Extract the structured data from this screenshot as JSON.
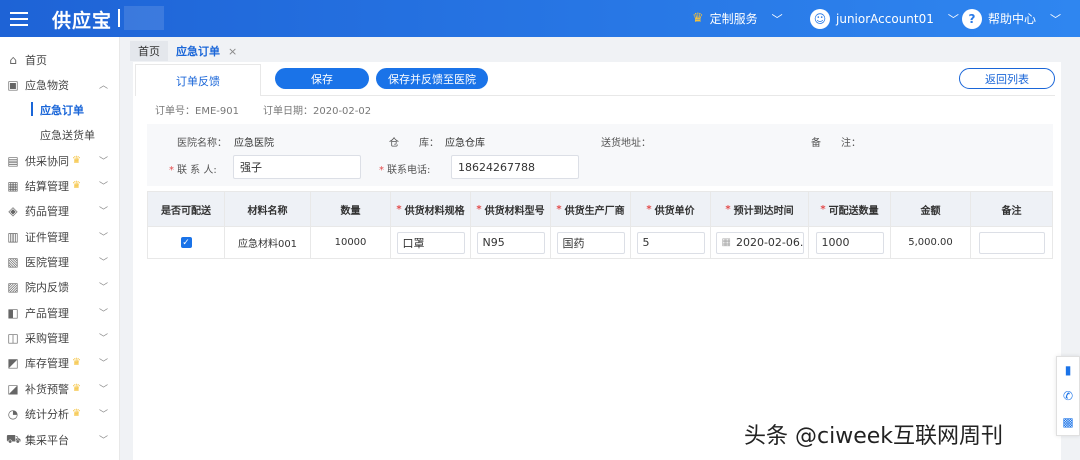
{
  "header": {
    "logo": "供应宝",
    "custom_service": "定制服务",
    "account": "juniorAccount01",
    "help": "帮助中心",
    "colors": {
      "bar": "#2a7be8",
      "crown": "#f5c23b"
    }
  },
  "sidebar": {
    "items": [
      {
        "icon": "home-icon",
        "label": "首页"
      },
      {
        "icon": "box-icon",
        "label": "应急物资"
      },
      {
        "label": "应急订单",
        "active": true
      },
      {
        "label": "应急送货单"
      },
      {
        "icon": "document-icon",
        "label": "供采协同",
        "crown": true
      },
      {
        "icon": "settlement-icon",
        "label": "结算管理",
        "crown": true
      },
      {
        "icon": "pill-icon",
        "label": "药品管理"
      },
      {
        "icon": "certificate-icon",
        "label": "证件管理"
      },
      {
        "icon": "hospital-icon",
        "label": "医院管理"
      },
      {
        "icon": "feedback-icon",
        "label": "院内反馈"
      },
      {
        "icon": "product-icon",
        "label": "产品管理"
      },
      {
        "icon": "purchase-icon",
        "label": "采购管理"
      },
      {
        "icon": "inventory-icon",
        "label": "库存管理",
        "crown": true
      },
      {
        "icon": "restock-icon",
        "label": "补货预警",
        "crown": true
      },
      {
        "icon": "stats-icon",
        "label": "统计分析",
        "crown": true
      },
      {
        "icon": "cart-icon",
        "label": "集采平台"
      }
    ]
  },
  "tabs": {
    "home": "首页",
    "current": "应急订单",
    "close": "×"
  },
  "page": {
    "subtab": "订单反馈",
    "save": "保存",
    "save_feedback": "保存并反馈至医院",
    "back": "返回列表",
    "order_no": "订单号：EME-901",
    "order_date": "订单日期：2020-02-02"
  },
  "info": {
    "hospital_label": "医院名称：",
    "hospital_value": "应急医院",
    "warehouse_label": "仓　　库：",
    "warehouse_value": "应急仓库",
    "address_label": "送货地址：",
    "remark_label": "备　　注：",
    "contact_label": "联  系  人:",
    "contact_value": "强子",
    "phone_label": "联系电话:",
    "phone_value": "18624267788"
  },
  "table": {
    "headers": [
      "是否可配送",
      "材料名称",
      "数量",
      "供货材料规格",
      "供货材料型号",
      "供货生产厂商",
      "供货单价",
      "预计到达时间",
      "可配送数量",
      "金额",
      "备注"
    ],
    "rows": [
      {
        "deliverable": "✓",
        "name": "应急材料001",
        "qty": "10000",
        "spec": "口罩",
        "model": "N95",
        "maker": "国药",
        "price": "5",
        "eta": "2020-02-06..",
        "deliver_qty": "1000",
        "amount": "5,000.00",
        "remark": ""
      }
    ]
  },
  "watermark": "头条 @ciweek互联网周刊"
}
